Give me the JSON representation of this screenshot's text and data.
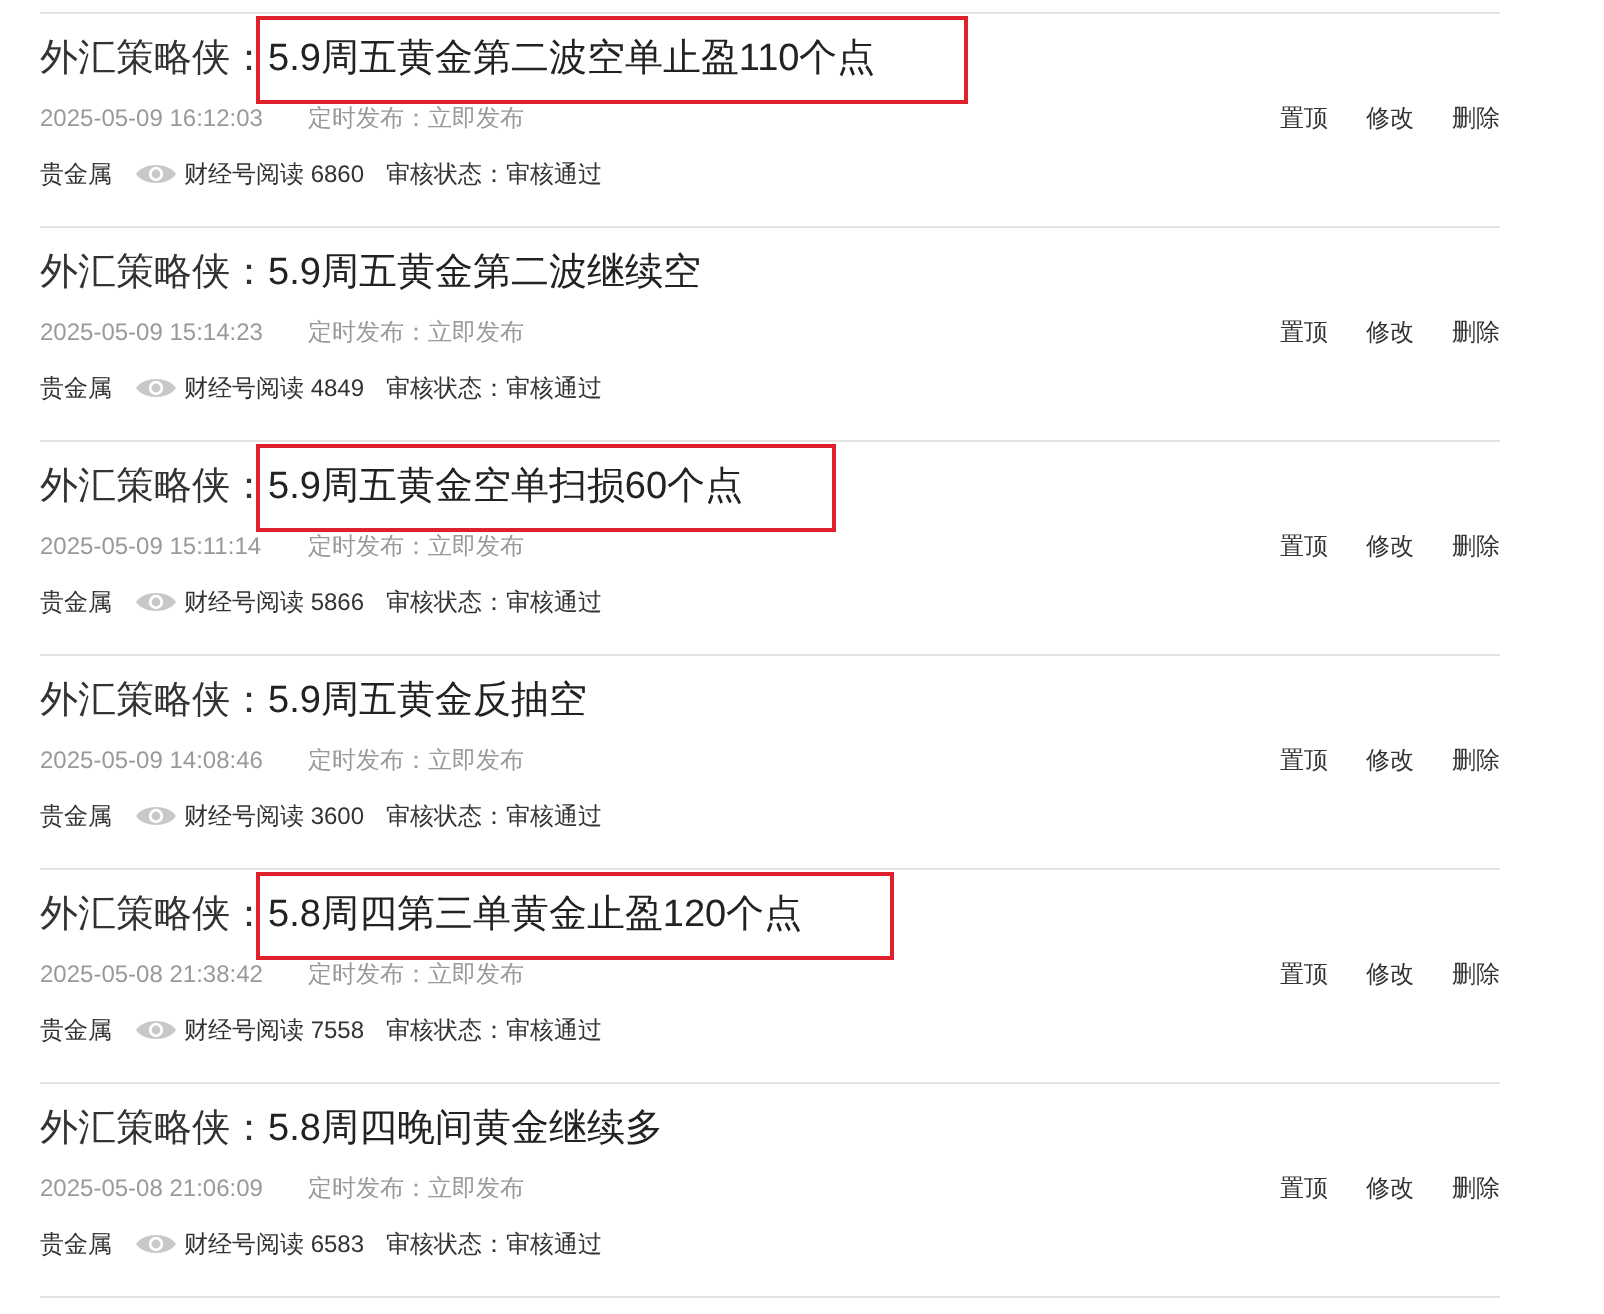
{
  "posts": [
    {
      "author": "外汇策略侠：",
      "title": "5.9周五黄金第二波空单止盈110个点",
      "highlighted": true,
      "time": "2025-05-09 16:12:03",
      "schedule": "定时发布：立即发布",
      "category": "贵金属",
      "reads": "财经号阅读 6860",
      "review": "审核状态：审核通过",
      "actions": [
        "置顶",
        "修改",
        "删除"
      ]
    },
    {
      "author": "外汇策略侠：",
      "title": "5.9周五黄金第二波继续空",
      "highlighted": false,
      "time": "2025-05-09 15:14:23",
      "schedule": "定时发布：立即发布",
      "category": "贵金属",
      "reads": "财经号阅读 4849",
      "review": "审核状态：审核通过",
      "actions": [
        "置顶",
        "修改",
        "删除"
      ]
    },
    {
      "author": "外汇策略侠：",
      "title": "5.9周五黄金空单扫损60个点",
      "highlighted": true,
      "time": "2025-05-09 15:11:14",
      "schedule": "定时发布：立即发布",
      "category": "贵金属",
      "reads": "财经号阅读 5866",
      "review": "审核状态：审核通过",
      "actions": [
        "置顶",
        "修改",
        "删除"
      ]
    },
    {
      "author": "外汇策略侠：",
      "title": "5.9周五黄金反抽空",
      "highlighted": false,
      "time": "2025-05-09 14:08:46",
      "schedule": "定时发布：立即发布",
      "category": "贵金属",
      "reads": "财经号阅读 3600",
      "review": "审核状态：审核通过",
      "actions": [
        "置顶",
        "修改",
        "删除"
      ]
    },
    {
      "author": "外汇策略侠：",
      "title": "5.8周四第三单黄金止盈120个点",
      "highlighted": true,
      "time": "2025-05-08 21:38:42",
      "schedule": "定时发布：立即发布",
      "category": "贵金属",
      "reads": "财经号阅读 7558",
      "review": "审核状态：审核通过",
      "actions": [
        "置顶",
        "修改",
        "删除"
      ]
    },
    {
      "author": "外汇策略侠：",
      "title": "5.8周四晚间黄金继续多",
      "highlighted": false,
      "time": "2025-05-08 21:06:09",
      "schedule": "定时发布：立即发布",
      "category": "贵金属",
      "reads": "财经号阅读 6583",
      "review": "审核状态：审核通过",
      "actions": [
        "置顶",
        "修改",
        "删除"
      ]
    }
  ]
}
